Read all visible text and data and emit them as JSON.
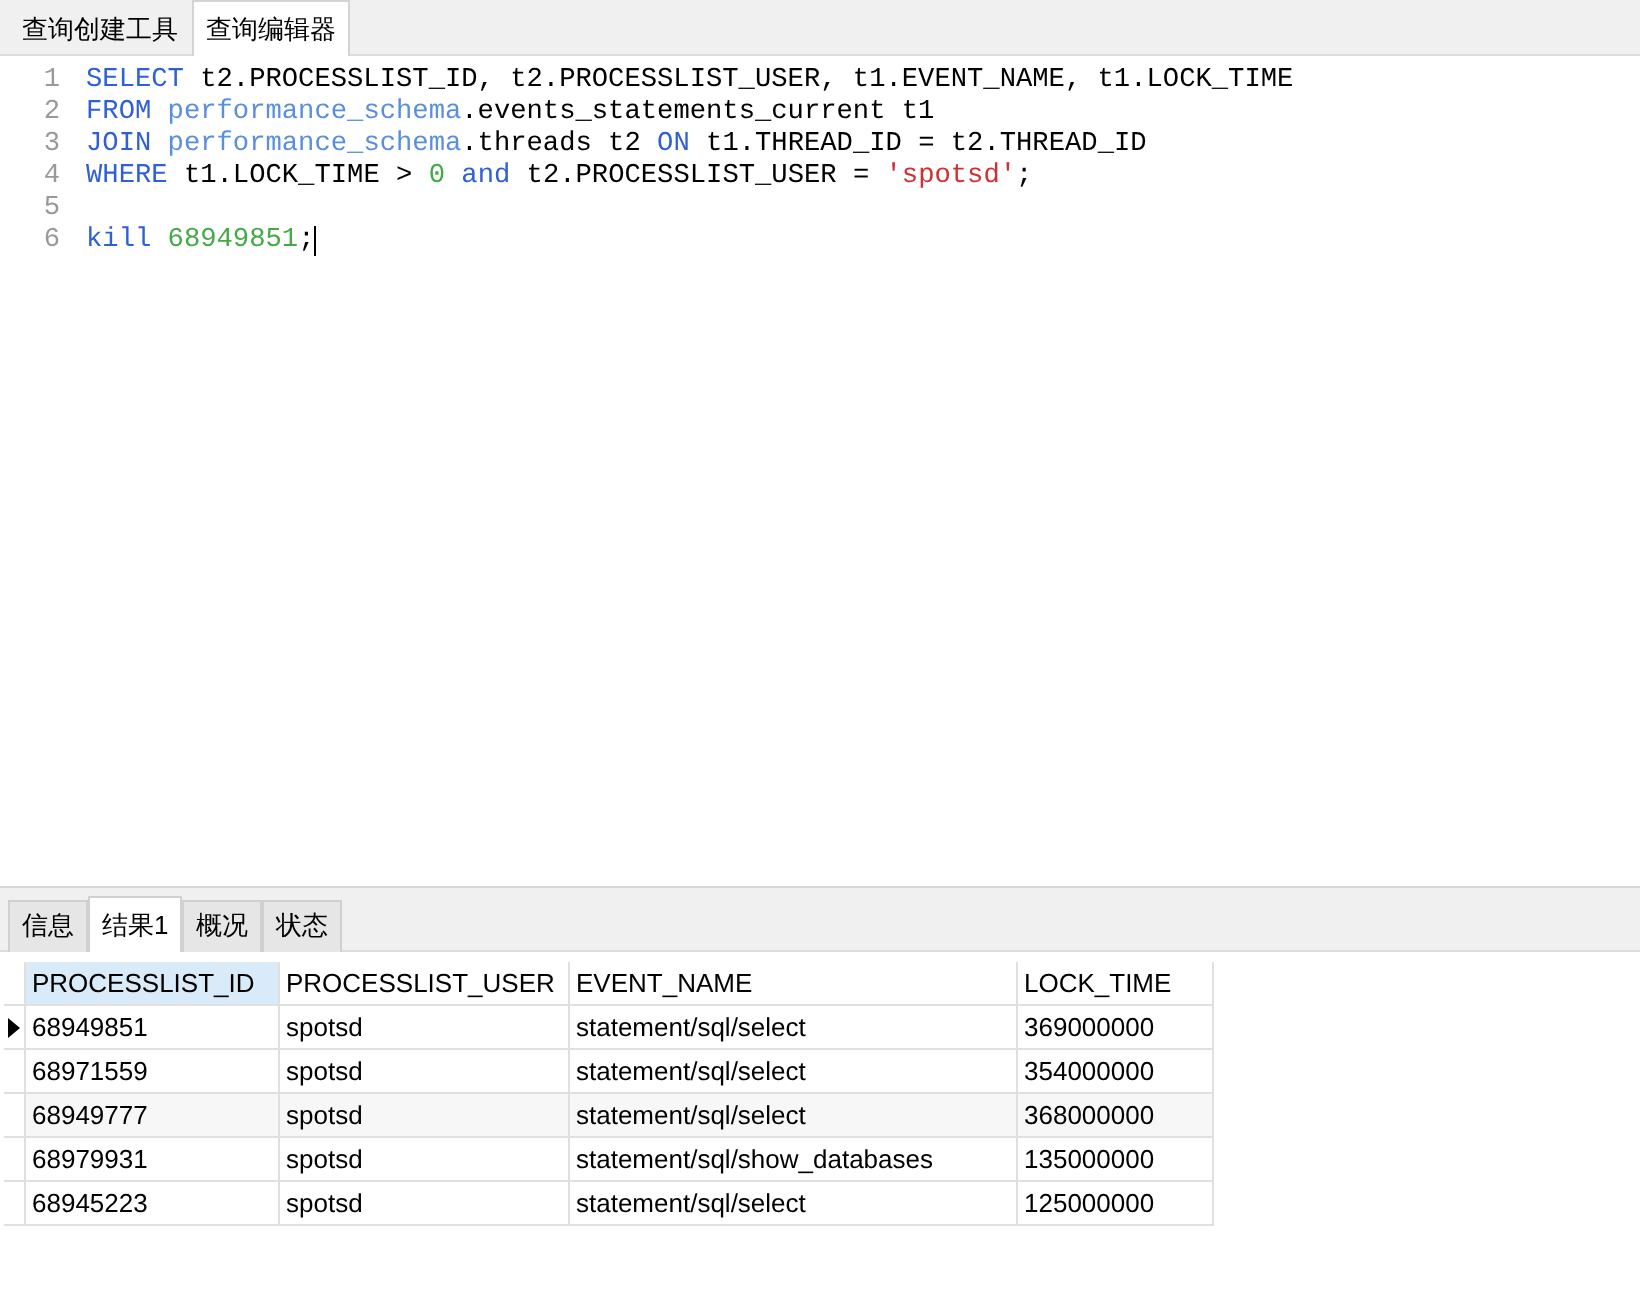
{
  "editor_tabs": [
    {
      "label": "查询创建工具",
      "selected": false
    },
    {
      "label": "查询编辑器",
      "selected": true
    }
  ],
  "code_lines": [
    {
      "number": "1",
      "tokens": [
        {
          "kind": "keyword",
          "text": "SELECT"
        },
        {
          "kind": "plain",
          "text": " t2.PROCESSLIST_ID, t2.PROCESSLIST_USER, t1.EVENT_NAME, t1.LOCK_TIME"
        }
      ]
    },
    {
      "number": "2",
      "tokens": [
        {
          "kind": "keyword",
          "text": "FROM"
        },
        {
          "kind": "schema",
          "text": " performance_schema"
        },
        {
          "kind": "plain",
          "text": ".events_statements_current t1"
        }
      ]
    },
    {
      "number": "3",
      "tokens": [
        {
          "kind": "keyword",
          "text": "JOIN"
        },
        {
          "kind": "schema",
          "text": " performance_schema"
        },
        {
          "kind": "plain",
          "text": ".threads t2 "
        },
        {
          "kind": "keyword",
          "text": "ON"
        },
        {
          "kind": "plain",
          "text": " t1.THREAD_ID = t2.THREAD_ID"
        }
      ]
    },
    {
      "number": "4",
      "tokens": [
        {
          "kind": "keyword",
          "text": "WHERE"
        },
        {
          "kind": "plain",
          "text": " t1.LOCK_TIME > "
        },
        {
          "kind": "number",
          "text": "0"
        },
        {
          "kind": "keyword",
          "text": " and"
        },
        {
          "kind": "plain",
          "text": " t2.PROCESSLIST_USER = "
        },
        {
          "kind": "string",
          "text": "'spotsd'"
        },
        {
          "kind": "plain",
          "text": ";"
        }
      ]
    },
    {
      "number": "5"
    },
    {
      "number": "6",
      "cursor": true,
      "tokens": [
        {
          "kind": "keyword",
          "text": "kill"
        },
        {
          "kind": "number",
          "text": " 68949851"
        },
        {
          "kind": "plain",
          "text": ";"
        }
      ]
    }
  ],
  "result_tabs": [
    {
      "label": "信息",
      "selected": false
    },
    {
      "label": "结果1",
      "selected": true
    },
    {
      "label": "概况",
      "selected": false
    },
    {
      "label": "状态",
      "selected": false
    }
  ],
  "table": {
    "columns": [
      {
        "label": "PROCESSLIST_ID",
        "selected": true
      },
      {
        "label": "PROCESSLIST_USER",
        "selected": false
      },
      {
        "label": "EVENT_NAME",
        "selected": false
      },
      {
        "label": "LOCK_TIME",
        "selected": false
      }
    ],
    "rows": [
      {
        "selected": true,
        "cells": [
          "68949851",
          "spotsd",
          "statement/sql/select",
          "369000000"
        ]
      },
      {
        "selected": false,
        "cells": [
          "68971559",
          "spotsd",
          "statement/sql/select",
          "354000000"
        ]
      },
      {
        "selected": false,
        "cells": [
          "68949777",
          "spotsd",
          "statement/sql/select",
          "368000000"
        ]
      },
      {
        "selected": false,
        "cells": [
          "68979931",
          "spotsd",
          "statement/sql/show_databases",
          "135000000"
        ]
      },
      {
        "selected": false,
        "cells": [
          "68945223",
          "spotsd",
          "statement/sql/select",
          "125000000"
        ]
      }
    ]
  }
}
